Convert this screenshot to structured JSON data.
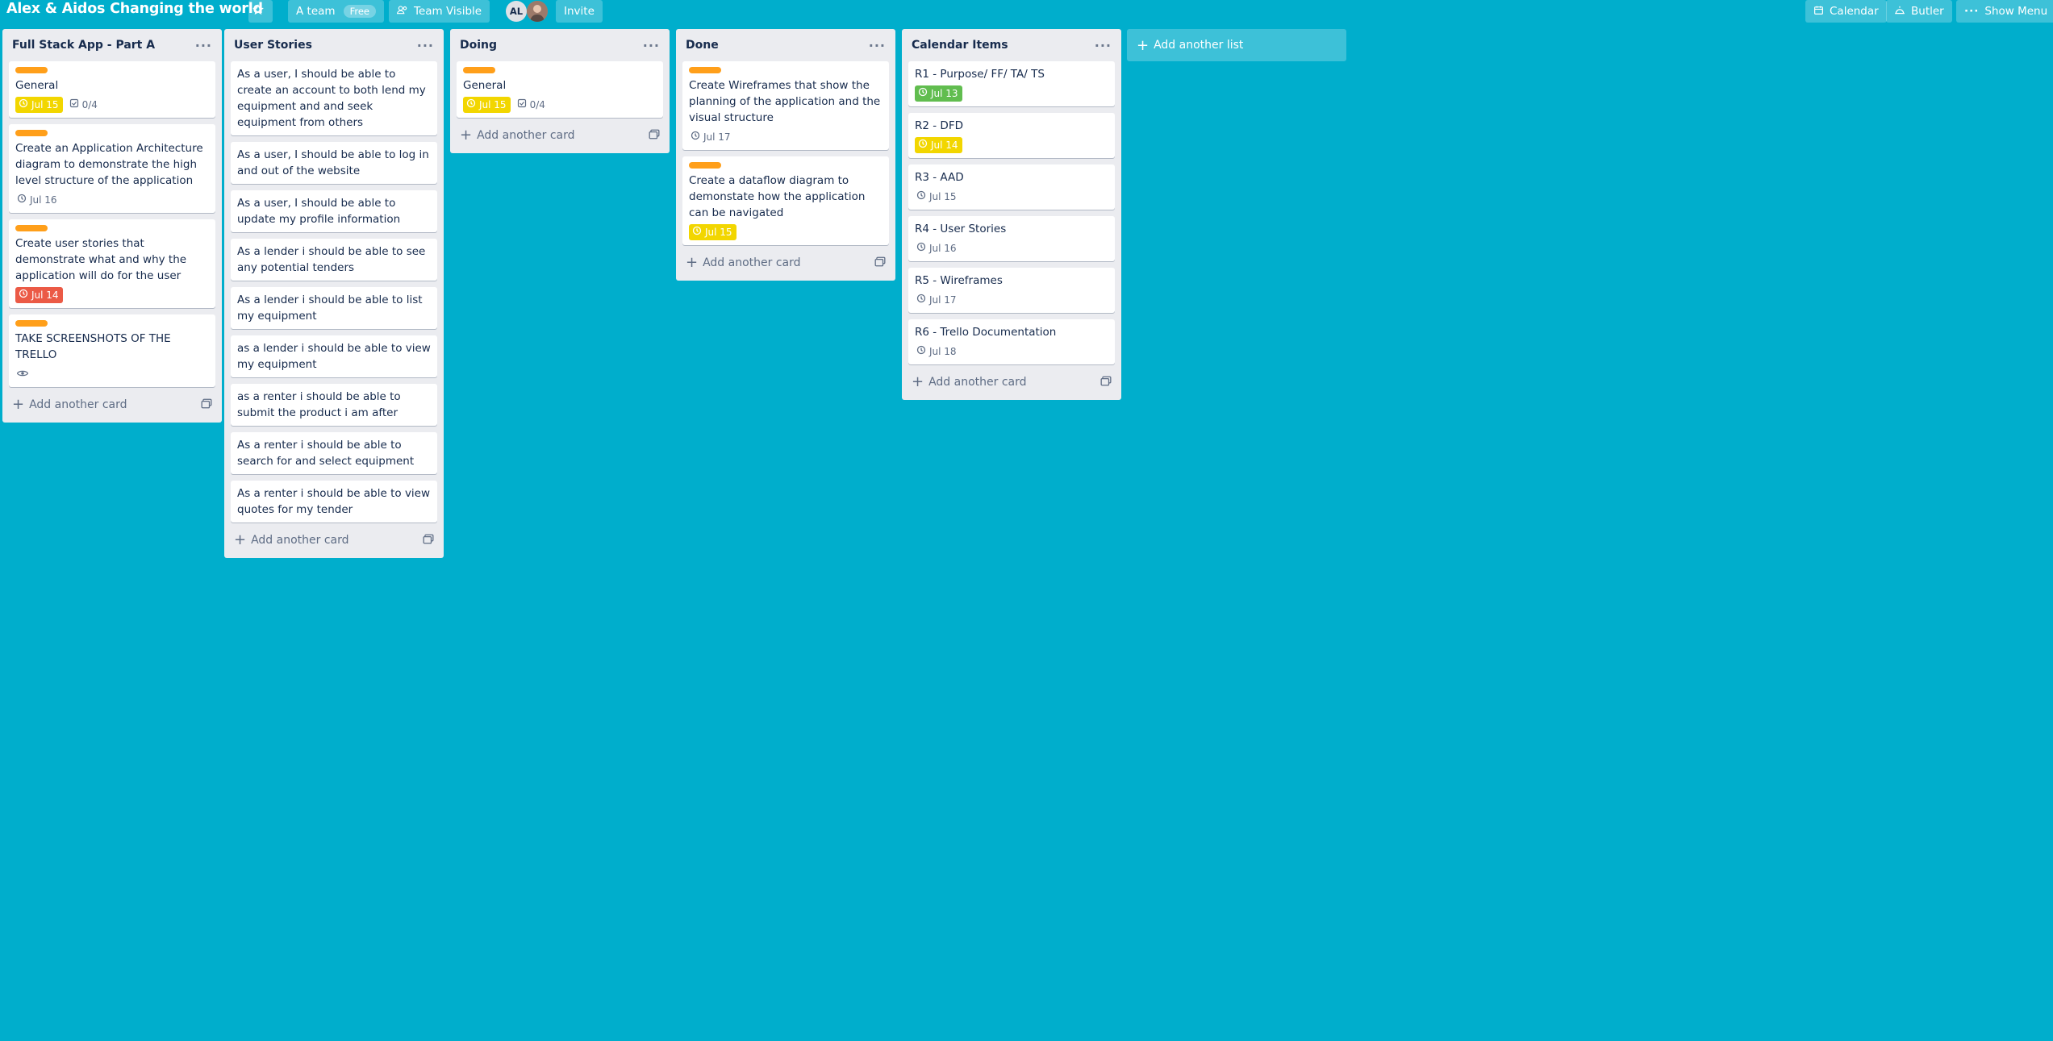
{
  "header": {
    "board_title": "Alex & Aidos Changing the world",
    "team_name": "A team",
    "team_badge": "Free",
    "visibility": "Team Visible",
    "member_initials": "AL",
    "invite": "Invite",
    "calendar": "Calendar",
    "butler": "Butler",
    "show_menu": "Show Menu"
  },
  "add_card_label": "Add another card",
  "add_list_label": "Add another list",
  "lists": [
    {
      "title": "Full Stack App - Part A",
      "cards": [
        {
          "title": "General",
          "label_color": "#ff9f1a",
          "due": "Jul 15",
          "due_style": "yellow",
          "checklist": "0/4"
        },
        {
          "title": "Create an Application Architecture diagram to demonstrate the high level structure of the application",
          "label_color": "#ff9f1a",
          "due": "Jul 16",
          "due_style": "plain"
        },
        {
          "title": "Create user stories that demonstrate what and why the application will do for the user",
          "label_color": "#ff9f1a",
          "due": "Jul 14",
          "due_style": "red"
        },
        {
          "title": "TAKE SCREENSHOTS OF THE TRELLO",
          "label_color": "#ff9f1a",
          "watch": true
        }
      ]
    },
    {
      "title": "User Stories",
      "cards": [
        {
          "title": "As a user, I should be able to create an account to both lend my equipment and and seek equipment from others"
        },
        {
          "title": "As a user, I should be able to log in and out of the website"
        },
        {
          "title": "As a user, I should be able to update my profile information"
        },
        {
          "title": "As a lender i should be able to see any potential tenders"
        },
        {
          "title": "As a lender i should be able to list my equipment"
        },
        {
          "title": "as a lender i should be able to view my equipment"
        },
        {
          "title": "as a renter i should be able to submit the product i am after"
        },
        {
          "title": "As a renter i should be able to search for and select equipment"
        },
        {
          "title": "As a renter i should be able to view quotes for my tender"
        }
      ]
    },
    {
      "title": "Doing",
      "cards": [
        {
          "title": "General",
          "label_color": "#ff9f1a",
          "due": "Jul 15",
          "due_style": "yellow",
          "checklist": "0/4"
        }
      ]
    },
    {
      "title": "Done",
      "cards": [
        {
          "title": "Create Wireframes that show the planning of the application and the visual structure",
          "label_color": "#ff9f1a",
          "due": "Jul 17",
          "due_style": "plain"
        },
        {
          "title": "Create a dataflow diagram to demonstate how the application can be navigated",
          "label_color": "#ff9f1a",
          "due": "Jul 15",
          "due_style": "yellow"
        }
      ]
    },
    {
      "title": "Calendar Items",
      "cards": [
        {
          "title": "R1 - Purpose/ FF/ TA/ TS",
          "due": "Jul 13",
          "due_style": "green"
        },
        {
          "title": "R2 - DFD",
          "due": "Jul 14",
          "due_style": "yellow"
        },
        {
          "title": "R3 - AAD",
          "due": "Jul 15",
          "due_style": "plain"
        },
        {
          "title": "R4 - User Stories",
          "due": "Jul 16",
          "due_style": "plain"
        },
        {
          "title": "R5 - Wireframes",
          "due": "Jul 17",
          "due_style": "plain"
        },
        {
          "title": "R6 - Trello Documentation",
          "due": "Jul 18",
          "due_style": "plain"
        }
      ]
    }
  ]
}
